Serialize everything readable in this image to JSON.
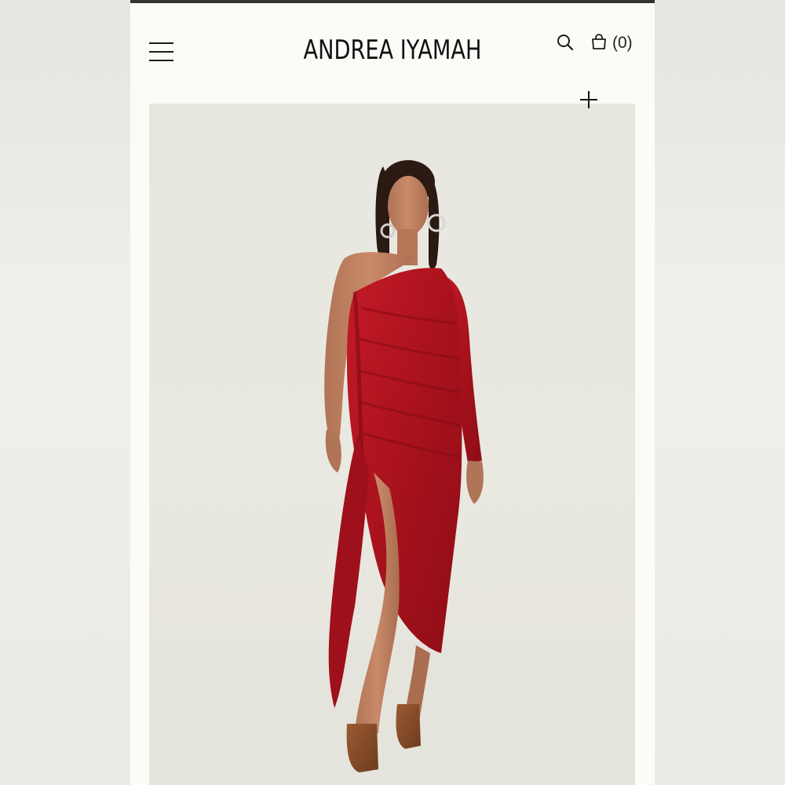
{
  "header": {
    "brand": "ANDREA IYAMAH",
    "cart_count": "(0)"
  },
  "icons": {
    "menu": "hamburger-menu-icon",
    "search": "search-icon",
    "cart": "shopping-bag-icon",
    "expand": "plus-icon"
  },
  "colors": {
    "page_bg": "#fbfbf8",
    "product_bg": "#e8e7df",
    "dress": "#b0141f",
    "text": "#111111"
  }
}
